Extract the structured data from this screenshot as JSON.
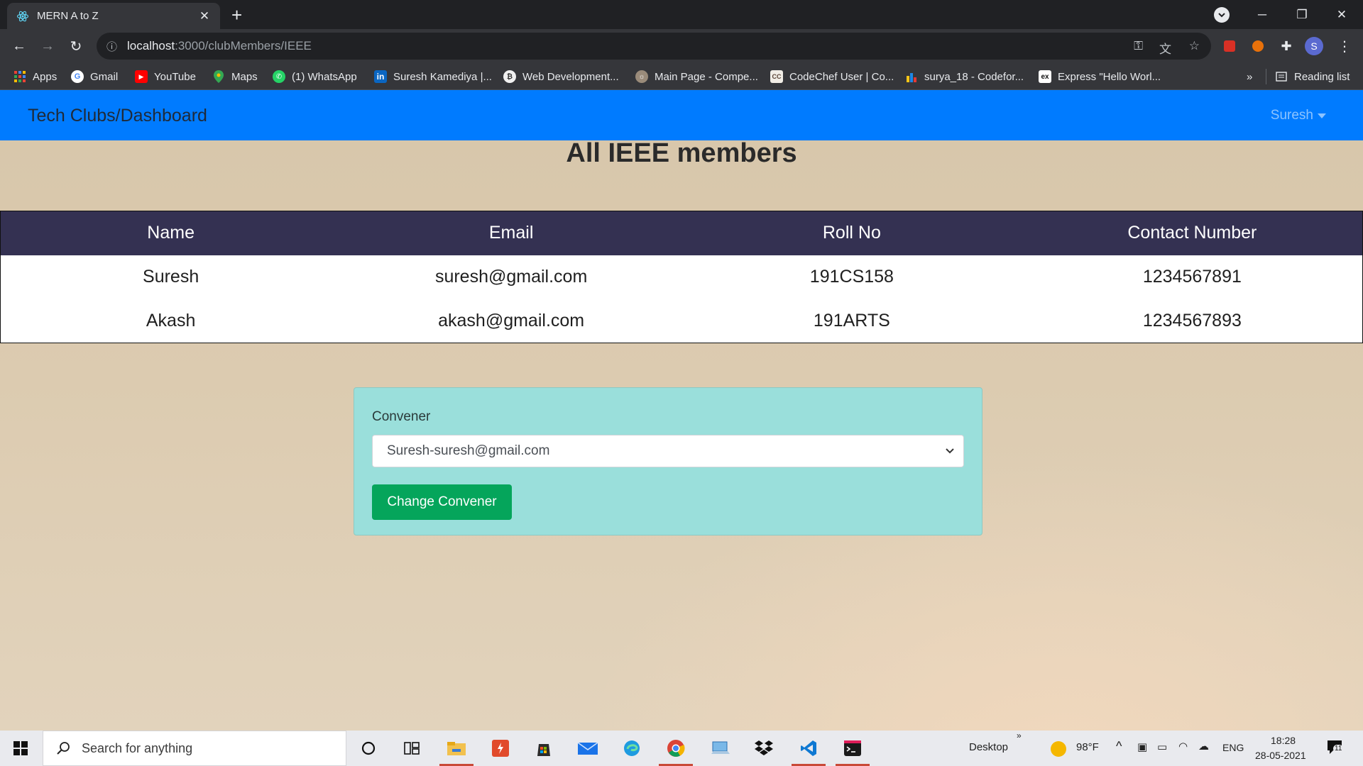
{
  "browser": {
    "tab_title": "MERN A to Z",
    "url_host": "localhost",
    "url_path": ":3000/clubMembers/IEEE",
    "bookmarks": [
      {
        "label": "Apps",
        "icon": "apps-grid-icon",
        "color": "#4285f4"
      },
      {
        "label": "Gmail",
        "icon": "google-icon",
        "color": "#ea4335"
      },
      {
        "label": "YouTube",
        "icon": "youtube-icon",
        "color": "#ff0000"
      },
      {
        "label": "Maps",
        "icon": "maps-pin-icon",
        "color": "#34a853"
      },
      {
        "label": "(1) WhatsApp",
        "icon": "whatsapp-icon",
        "color": "#25d366"
      },
      {
        "label": "Suresh Kamediya |...",
        "icon": "linkedin-icon",
        "color": "#0a66c2"
      },
      {
        "label": "Web Development...",
        "icon": "web-dev-icon",
        "color": "#e8b84a"
      },
      {
        "label": "Main Page - Compe...",
        "icon": "wiki-icon",
        "color": "#9a8b7a"
      },
      {
        "label": "CodeChef User | Co...",
        "icon": "codechef-icon",
        "color": "#5b4638"
      },
      {
        "label": "surya_18 - Codefor...",
        "icon": "codeforces-icon",
        "color": "#f5c518"
      },
      {
        "label": "Express \"Hello Worl...",
        "icon": "express-icon",
        "color": "#ffffff"
      }
    ],
    "more_bookmarks": "»",
    "reading_list": "Reading list",
    "profile_initial": "S"
  },
  "app": {
    "brand": "Tech Clubs/Dashboard",
    "user": "Suresh",
    "heading": "All IEEE members",
    "table": {
      "headers": [
        "Name",
        "Email",
        "Roll No",
        "Contact Number"
      ],
      "rows": [
        [
          "Suresh",
          "suresh@gmail.com",
          "191CS158",
          "1234567891"
        ],
        [
          "Akash",
          "akash@gmail.com",
          "191ARTS",
          "1234567893"
        ]
      ]
    },
    "convener": {
      "label": "Convener",
      "selected": "Suresh-suresh@gmail.com",
      "button": "Change Convener"
    }
  },
  "taskbar": {
    "search_placeholder": "Search for anything",
    "desktop_label": "Desktop",
    "weather": "98°F",
    "language": "ENG",
    "time": "18:28",
    "date": "28-05-2021",
    "notification_count": "11"
  },
  "colors": {
    "navbar": "#007bff",
    "table_header": "#343152",
    "card": "#9adfdb",
    "button": "#05a55b"
  }
}
